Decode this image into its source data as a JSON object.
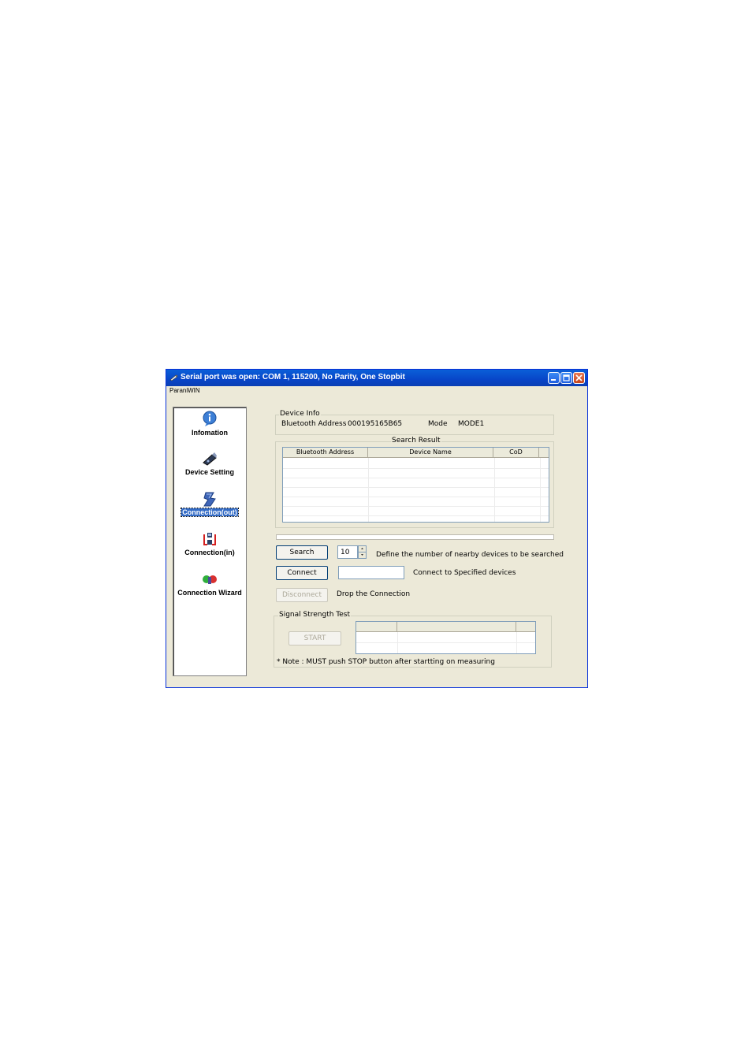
{
  "window": {
    "title": "Serial port was open: COM 1, 115200, No Parity, One Stopbit",
    "menu": "ParaniWIN"
  },
  "sidebar": {
    "items": [
      {
        "label": "Infomation",
        "icon": "info-icon"
      },
      {
        "label": "Device Setting",
        "icon": "device-icon"
      },
      {
        "label": "Connection(out)",
        "icon": "connection-out-icon",
        "selected": true
      },
      {
        "label": "Connection(in)",
        "icon": "connection-in-icon"
      },
      {
        "label": "Connection Wizard",
        "icon": "wizard-icon"
      }
    ]
  },
  "device_info": {
    "group_label": "Device Info",
    "address_label": "Bluetooth Address",
    "address_value": "000195165B65",
    "mode_label": "Mode",
    "mode_value": "MODE1"
  },
  "search_result": {
    "group_label": "Search Result",
    "columns": [
      "Bluetooth Address",
      "Device Name",
      "CoD"
    ],
    "rows": []
  },
  "controls": {
    "search_label": "Search",
    "count_value": "10",
    "count_desc": "Define the number of nearby devices to be searched",
    "connect_label": "Connect",
    "connect_value": "",
    "connect_desc": "Connect to Specified devices",
    "disconnect_label": "Disconnect",
    "disconnect_desc": "Drop the Connection"
  },
  "signal": {
    "group_label": "Signal Strength Test",
    "start_label": "START",
    "note": "* Note : MUST push STOP button after startting on measuring"
  },
  "colors": {
    "titlebar": "#0a5fd8",
    "window_bg": "#ece9d8",
    "selection": "#316ac5"
  }
}
